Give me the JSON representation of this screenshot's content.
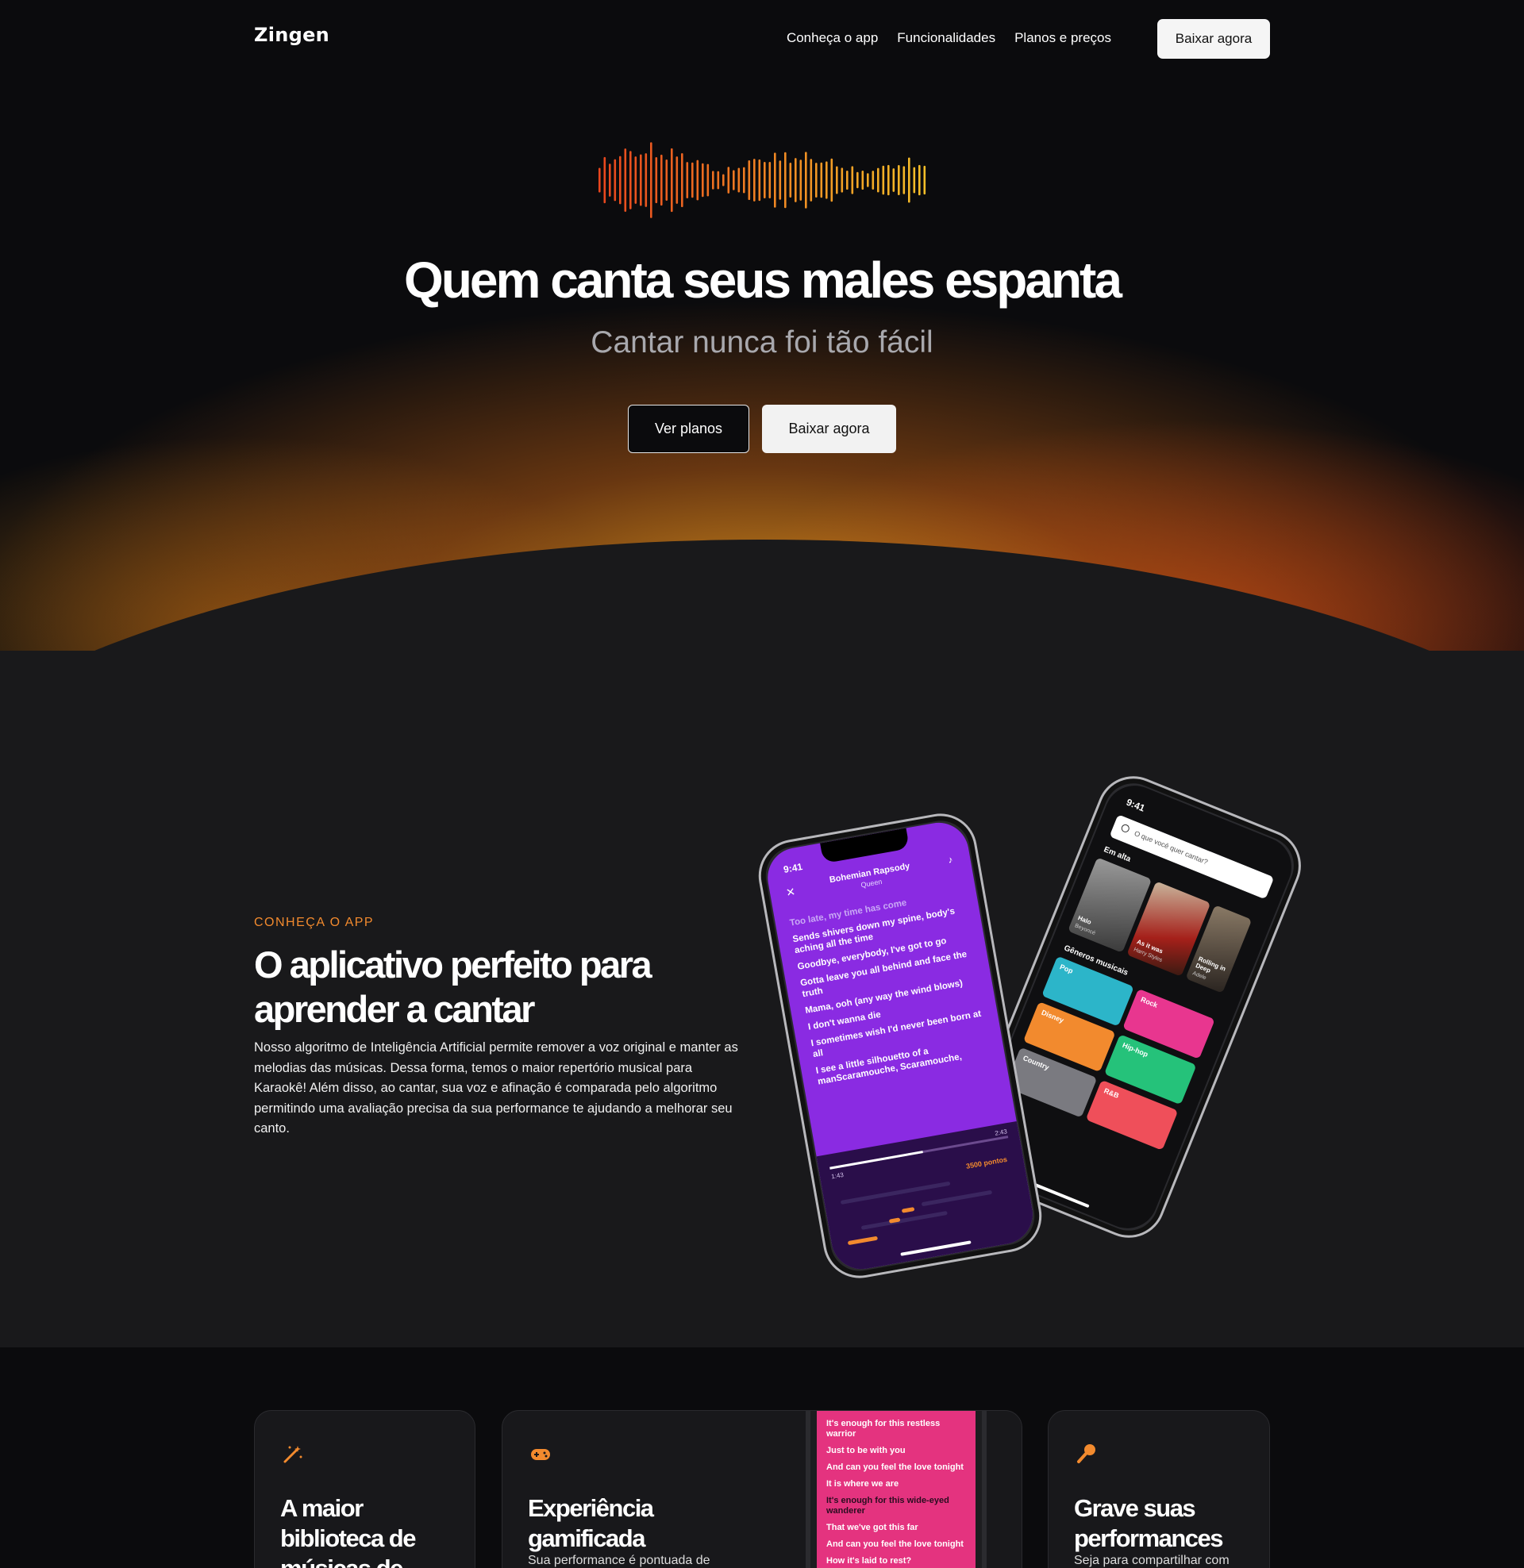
{
  "nav": {
    "logo": "Zingen",
    "links": [
      "Conheça o app",
      "Funcionalidades",
      "Planos e preços"
    ],
    "cta": "Baixar agora"
  },
  "hero": {
    "title": "Quem canta seus males espanta",
    "subtitle": "Cantar nunca foi tão fácil",
    "btn_plans": "Ver planos",
    "btn_download": "Baixar agora"
  },
  "about": {
    "eyebrow": "CONHEÇA O APP",
    "title": "O aplicativo perfeito para aprender a cantar",
    "body": "Nosso algoritmo de Inteligência Artificial permite remover a voz original e manter as melodias das músicas. Dessa forma, temos o maior repertório musical para Karaokê! Além disso, ao cantar, sua voz e afinação é comparada pelo algoritmo permitindo uma avaliação precisa da sua performance te ajudando a melhorar seu canto."
  },
  "phone_karaoke": {
    "time": "9:41",
    "song": "Bohemian Rapsody",
    "artist": "Queen",
    "lyrics": [
      "Too late, my time has come",
      "Sends shivers down my spine, body's aching all the time",
      "Goodbye, everybody, I've got to go",
      "Gotta leave you all behind and face the truth",
      "Mama, ooh (any way the wind blows)",
      "I don't wanna die",
      "I sometimes wish I'd never been born at all",
      "I see a little silhouetto of a manScaramouche, Scaramouche,"
    ],
    "elapsed": "1:43",
    "total": "2:43",
    "points": "3500 pontos",
    "progress": 0.52
  },
  "phone_browse": {
    "time": "9:41",
    "search_placeholder": "O que você quer cantar?",
    "trending_label": "Em alta",
    "trending": [
      {
        "title": "Halo",
        "artist": "Beyoncé"
      },
      {
        "title": "As it was",
        "artist": "Harry Styles"
      },
      {
        "title": "Rolling in Deep",
        "artist": "Adele"
      }
    ],
    "genres_label": "Gêneros musicais",
    "genres": [
      "Pop",
      "Rock",
      "Disney",
      "Hip-hop",
      "Country",
      "R&B"
    ]
  },
  "features": [
    {
      "title": "A maior biblioteca de músicas de",
      "desc": ""
    },
    {
      "title": "Experiência gamificada",
      "desc": "Sua performance é pontuada de"
    },
    {
      "title": "Grave suas performances",
      "desc": "Seja para compartilhar com"
    }
  ],
  "feature_lyrics": [
    "It's enough for this restless warrior",
    "Just to be with you",
    "And can you feel the love tonight",
    "It is where we are",
    "It's enough for this wide-eyed wanderer",
    "That we've got this far",
    "And can you feel the love tonight",
    "How it's laid to rest?"
  ],
  "colors": {
    "accent": "#f28a2e",
    "purple": "#8a2be2",
    "pink": "#e4337f",
    "background": "#0b0b0d",
    "section": "#19191b"
  }
}
